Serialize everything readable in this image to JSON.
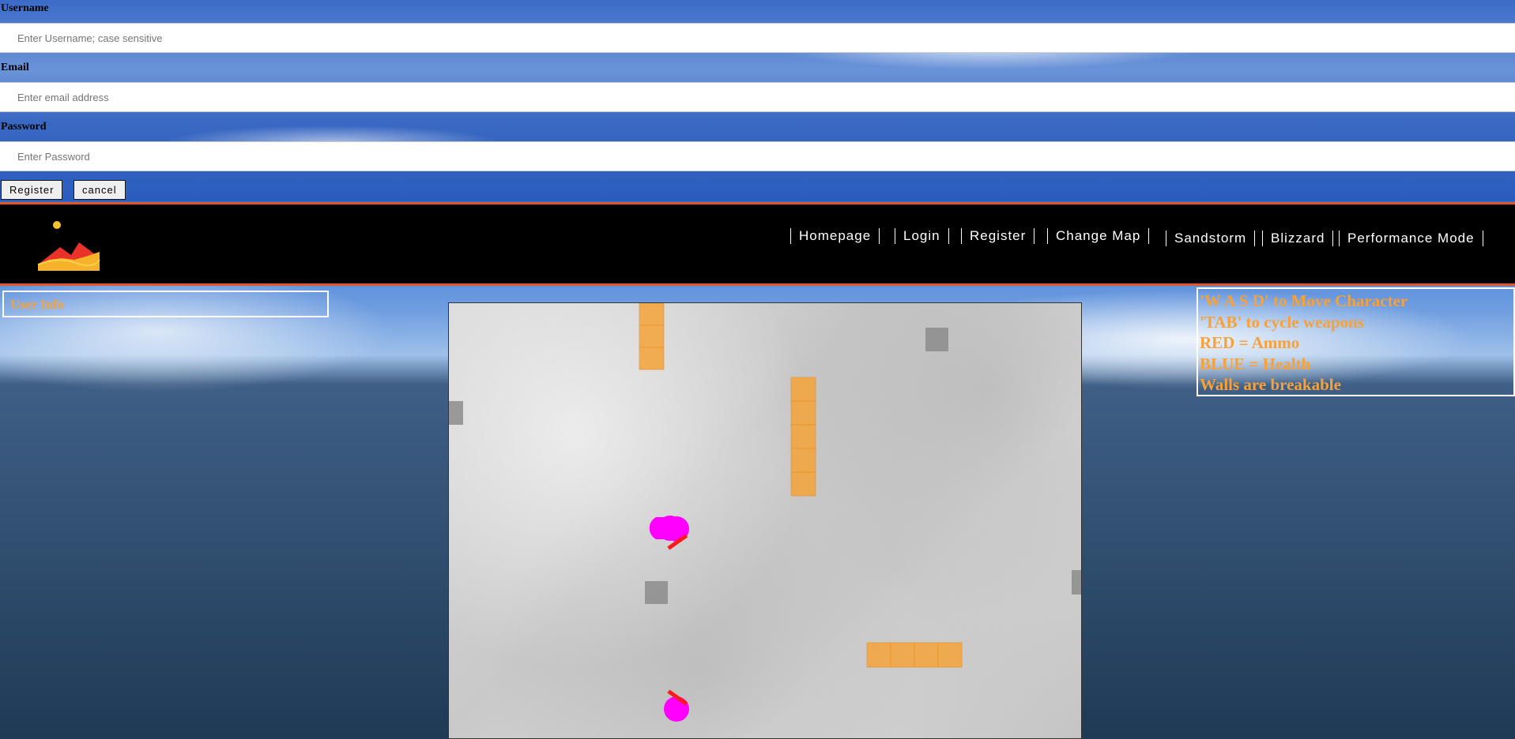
{
  "register_form": {
    "username_label": "Username",
    "username_placeholder": "Enter Username; case sensitive",
    "email_label": "Email",
    "email_placeholder": "Enter email address",
    "password_label": "Password",
    "password_placeholder": "Enter Password",
    "register_button": "Register",
    "cancel_button": "cancel"
  },
  "header": {
    "logo": "sunset-dunes-logo",
    "nav": [
      "Homepage",
      "Login",
      "Register",
      "Change Map",
      "Sandstorm",
      "Blizzard",
      "Performance Mode"
    ]
  },
  "user_info": {
    "title": "User Info"
  },
  "help": {
    "lines": [
      "'W A S D' to Move Character",
      "'TAB' to cycle weapons",
      "RED = Ammo",
      "BLUE = Health",
      "Walls are breakable"
    ]
  },
  "game": {
    "map": "snow",
    "colors": {
      "wall": "#f5a33a",
      "block": "#8c8c8c",
      "player": "#ff00ff",
      "weapon": "#ff1a1a"
    },
    "players": 2,
    "walls": 3,
    "blocks": 4
  }
}
